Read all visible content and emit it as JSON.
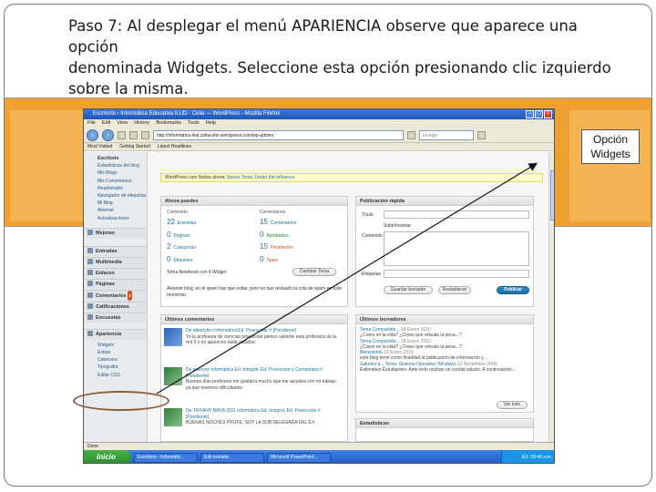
{
  "instruction": {
    "line1": "Paso 7: Al desplegar el menú APARIENCIA observe que aparece una opción",
    "line2": "denominada Widgets. Seleccione esta opción presionando clic izquierdo",
    "line3": "sobre la misma."
  },
  "callout": {
    "line1": "Opción",
    "line2": "Widgets"
  },
  "browser": {
    "title": "Escritorio ‹ Informática Educativa ILUD - Celia — WordPress - Mozilla Firefox",
    "menu": [
      "File",
      "Edit",
      "View",
      "History",
      "Bookmarks",
      "Tools",
      "Help"
    ],
    "url": "http://informatica-ilud.celiacolor.wordpress.com/wp-admin/",
    "search_placeholder": "Google",
    "bookmarks": [
      "Most Visited",
      "Getting Started",
      "Latest Headlines"
    ],
    "status": "Done"
  },
  "sidebar": {
    "top_items": [
      "Escritorio",
      "Estadísticas del blog",
      "Mis Blogs",
      "Mis Comentarios",
      "Readomattic",
      "Navegador de etiquetas",
      "Mi Blog",
      "Akismet",
      "Actualizaciones"
    ],
    "mejoras": "Mejoras",
    "sections": [
      {
        "label": "Entradas"
      },
      {
        "label": "Multimedia"
      },
      {
        "label": "Enlaces"
      },
      {
        "label": "Páginas"
      },
      {
        "label": "Comentarios",
        "badge": "3"
      },
      {
        "label": "Calificaciones"
      },
      {
        "label": "Encuestas"
      }
    ],
    "apariencia": "Apariencia",
    "apariencia_items": [
      "Widgets",
      "Extras",
      "Cabecera",
      "Tipografía",
      "Editar CSS"
    ]
  },
  "notice": {
    "prefix": "WordPress.com Notice ahora: ",
    "link": "Nuevo Tema: Under the Influence"
  },
  "ahora": {
    "title": "Ahora puedes",
    "col1_header": "Contenido",
    "col2_header": "Comentarios",
    "rows1": [
      {
        "n": "22",
        "label": "Entradas"
      },
      {
        "n": "0",
        "label": "Páginas"
      },
      {
        "n": "2",
        "label": "Categorías"
      },
      {
        "n": "0",
        "label": "Etiquetas"
      }
    ],
    "rows2": [
      {
        "n": "15",
        "label": "Comentarios"
      },
      {
        "n": "0",
        "label": "Aprobados"
      },
      {
        "n": "15",
        "label": "Pendientes"
      },
      {
        "n": "0",
        "label": "Spam"
      }
    ],
    "theme_line": "Tema Notebook con 4 Widget",
    "theme_button": "Cambiar Tema",
    "akismet_line": "Akismet blog, en el spam hay que evitar, pero no has revisado la cola de spam en este momento."
  },
  "publicacion": {
    "title": "Publicación rápida",
    "titulo_label": "Título",
    "media_label": "Subir/Insertar",
    "contenido_label": "Contenido",
    "etiquetas_label": "Etiquetas",
    "save_button": "Guardar borrador",
    "reset_button": "Restablecer",
    "publish_button": "Publicar"
  },
  "ultimos_comentarios": {
    "title": "Últimos comentarios",
    "items": [
      {
        "who": "De albertytiro Informática Ed. Preescolar # [Pendiente]",
        "body": "Yo la profesora de ciencias preescolar pienso valiente esta profesora de la red 2 y no apareces nada saludos-"
      },
      {
        "who": "De jasleyne Informática Ed. Integral, Ed. Preescolar y Comentario # [Pendiente]",
        "body": "Buenas días profesora me gustaría mucho que me ayudara con mi trabajo ya que tenemos dificultades"
      },
      {
        "who": "De TIFFANY MAYA 2011 Informática Ed. Integral, Ed. Preescolar # [Pendiente]",
        "body": "BUENAS NOCHES PROFE, SOY LA SUB DELEGADA DEL EX"
      }
    ]
  },
  "ultimos_borradores": {
    "title": "Últimos borradores",
    "items": [
      {
        "t": "Tema Compartido...",
        "d": "18 Enero 2010",
        "body": "¿Crees en la vida? ¿Crees que virtuale la pena...?"
      },
      {
        "t": "Tema Compartido...",
        "d": "18 Enero 2010",
        "body": "¿Crees en la vida? ¿Crees que virtuale la pena...?"
      },
      {
        "t": "Bienvenida",
        "d": "15 Enero 2010",
        "body": "este blog tiene como finalidad la publicación de información y..."
      },
      {
        "t": "Saludos a... Tema: Sistema Operativo Windows",
        "d": "22 Noviembre 2009",
        "body": "Estimados Estudiantes: Ante todo reciban un cordial saludo. A continuación..."
      }
    ],
    "view_button": "Ver todo"
  },
  "estadisticas": {
    "title": "Estadísticas"
  },
  "taskbar": {
    "start": "Inicio",
    "tasks": [
      "Escritorio ‹ Informátic...",
      "Edit entrada",
      "Microsoft PowerPoint..."
    ],
    "lang": "ES",
    "clock": "09:49 a.m."
  }
}
